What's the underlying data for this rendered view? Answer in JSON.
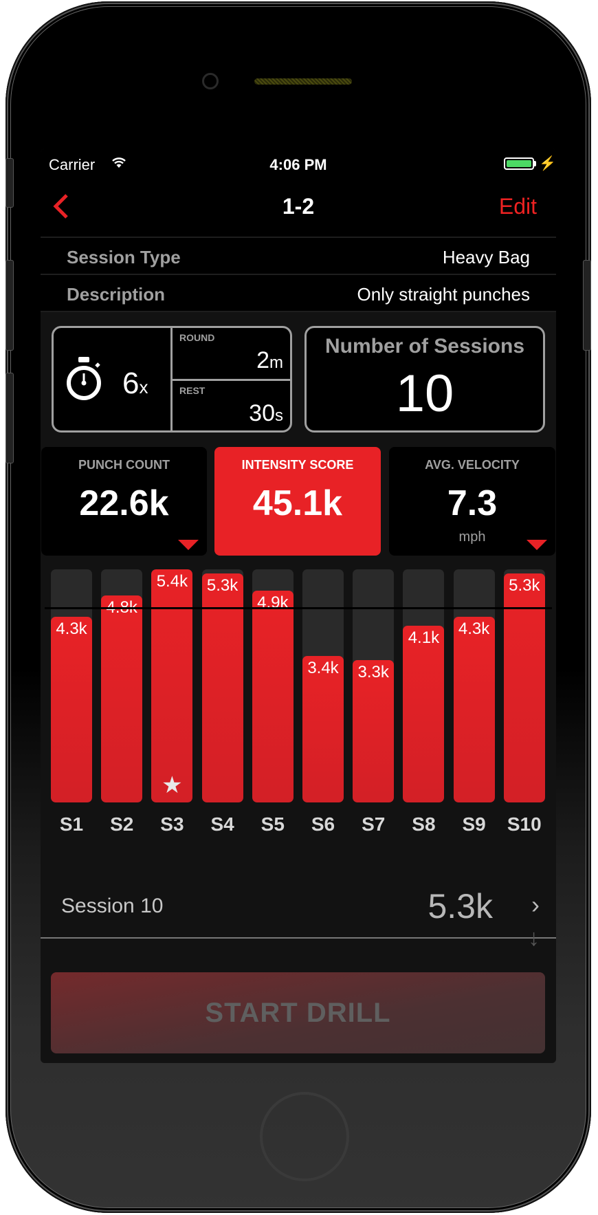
{
  "status_bar": {
    "carrier": "Carrier",
    "time": "4:06 PM",
    "battery_color": "#4cd964",
    "icons": [
      "wifi-icon",
      "battery-icon",
      "charging-bolt-icon"
    ]
  },
  "nav": {
    "back_icon": "chevron-left-icon",
    "title": "1-2",
    "edit_label": "Edit"
  },
  "details": [
    {
      "label": "Session Type",
      "value": "Heavy Bag"
    },
    {
      "label": "Description",
      "value": "Only straight punches"
    }
  ],
  "timer": {
    "icon": "stopwatch-icon",
    "rounds": "6",
    "rounds_unit": "x",
    "round_label": "ROUND",
    "round_value": "2",
    "round_unit": "m",
    "rest_label": "REST",
    "rest_value": "30",
    "rest_unit": "s"
  },
  "sessions_box": {
    "title": "Number of Sessions",
    "value": "10"
  },
  "stats": [
    {
      "label": "PUNCH COUNT",
      "value": "22.6k",
      "unit": "",
      "active": false,
      "dropdown": true
    },
    {
      "label": "INTENSITY SCORE",
      "value": "45.1k",
      "unit": "",
      "active": true,
      "dropdown": false
    },
    {
      "label": "AVG. VELOCITY",
      "value": "7.3",
      "unit": "mph",
      "active": false,
      "dropdown": true
    }
  ],
  "accent_color": "#e82226",
  "chart_data": {
    "type": "bar",
    "title": "",
    "xlabel": "",
    "ylabel": "Intensity Score",
    "categories": [
      "S1",
      "S2",
      "S3",
      "S4",
      "S5",
      "S6",
      "S7",
      "S8",
      "S9",
      "S10"
    ],
    "values": [
      4.3,
      4.8,
      5.4,
      5.3,
      4.9,
      3.4,
      3.3,
      4.1,
      4.3,
      5.3
    ],
    "value_labels": [
      "4.3k",
      "4.8k",
      "5.4k",
      "5.3k",
      "4.9k",
      "3.4k",
      "3.3k",
      "4.1k",
      "4.3k",
      "5.3k"
    ],
    "unit": "k",
    "ylim": [
      0,
      5.4
    ],
    "reference_line": 4.51,
    "best_index": 2,
    "best_marker": "star-icon",
    "grid": false
  },
  "selected_session": {
    "name": "Session 10",
    "value": "5.3k"
  },
  "start_button_label": "START DRILL"
}
